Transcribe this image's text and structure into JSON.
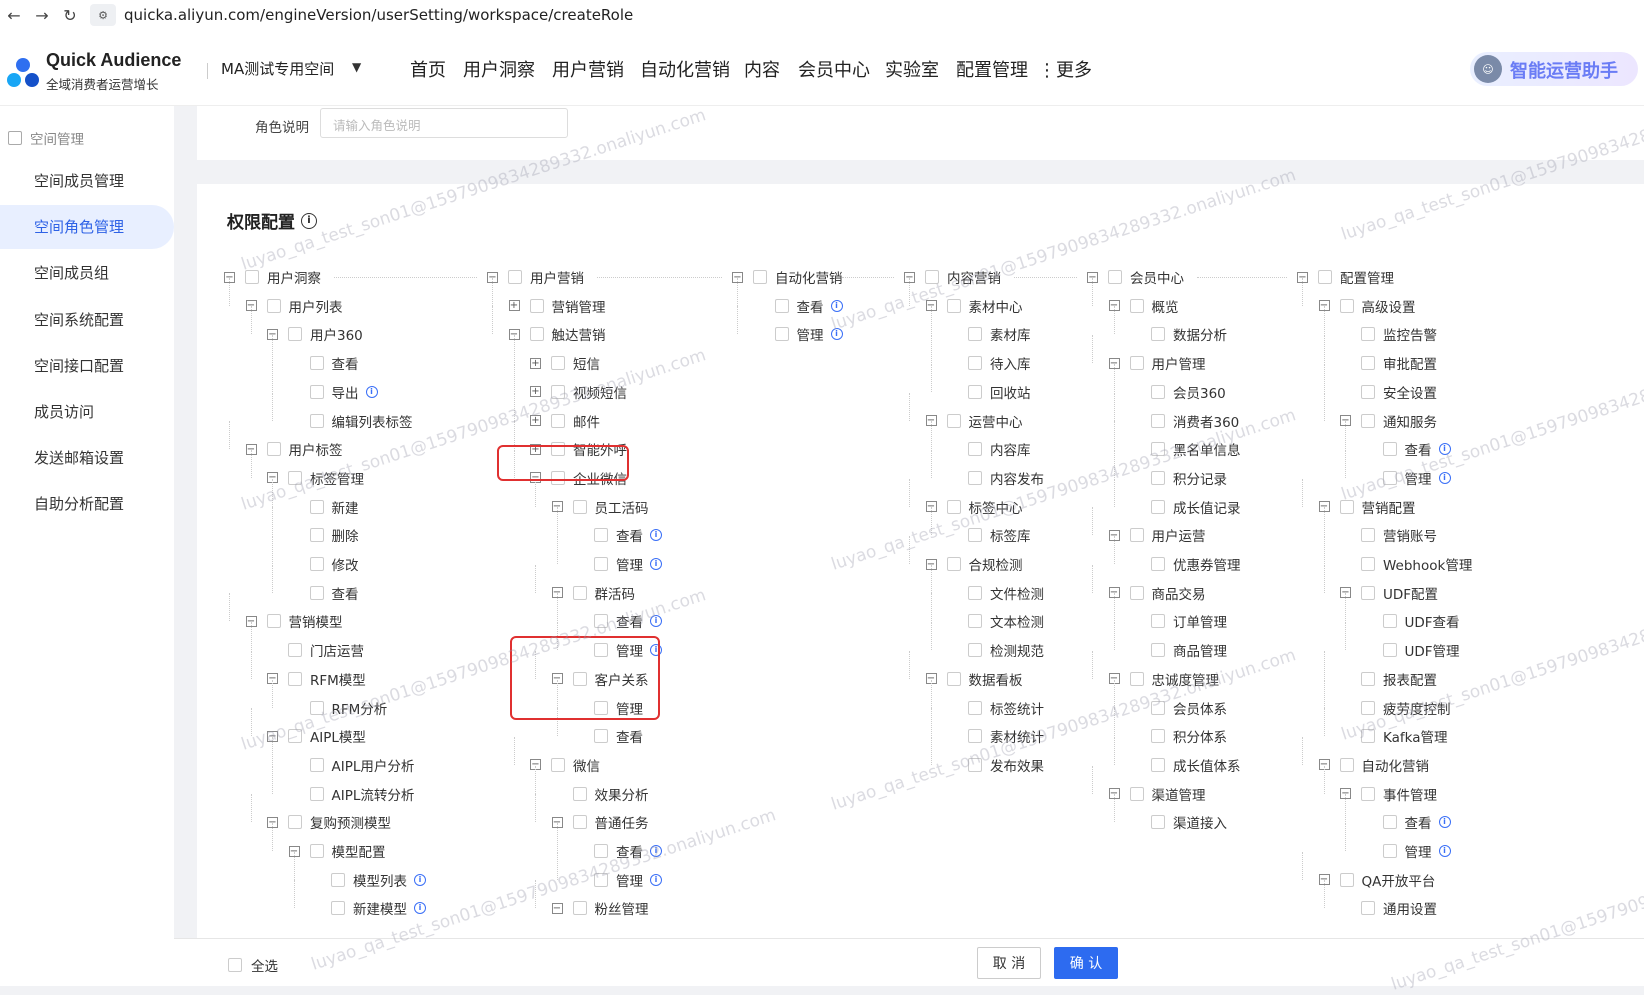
{
  "browser": {
    "url": "quicka.aliyun.com/engineVersion/userSetting/workspace/createRole"
  },
  "header": {
    "brand": "Quick Audience",
    "brand_sub": "全域消费者运营增长",
    "workspace": "MA测试专用空间",
    "menu": [
      "首页",
      "用户洞察",
      "用户营销",
      "自动化营销",
      "内容",
      "会员中心",
      "实验室",
      "配置管理",
      "更多"
    ],
    "ai_assistant": "智能运营助手"
  },
  "sidebar": {
    "group": "空间管理",
    "items": [
      "空间成员管理",
      "空间角色管理",
      "空间成员组",
      "空间系统配置",
      "空间接口配置",
      "成员访问",
      "发送邮箱设置",
      "自助分析配置"
    ],
    "active_index": 1
  },
  "role_desc": {
    "label": "角色说明",
    "placeholder": "请输入角色说明"
  },
  "perm": {
    "title": "权限配置",
    "columns": [
      [
        {
          "t": "用户洞察",
          "d": 0,
          "tog": "−"
        },
        {
          "t": "用户列表",
          "d": 1,
          "tog": "−"
        },
        {
          "t": "用户360",
          "d": 2,
          "tog": "−"
        },
        {
          "t": "查看",
          "d": 3
        },
        {
          "t": "导出",
          "d": 3,
          "info": true
        },
        {
          "t": "编辑列表标签",
          "d": 3
        },
        {
          "t": "用户标签",
          "d": 1,
          "tog": "−"
        },
        {
          "t": "标签管理",
          "d": 2,
          "tog": "−"
        },
        {
          "t": "新建",
          "d": 3
        },
        {
          "t": "删除",
          "d": 3
        },
        {
          "t": "修改",
          "d": 3
        },
        {
          "t": "查看",
          "d": 3
        },
        {
          "t": "营销模型",
          "d": 1,
          "tog": "−"
        },
        {
          "t": "门店运营",
          "d": 2
        },
        {
          "t": "RFM模型",
          "d": 2,
          "tog": "−"
        },
        {
          "t": "RFM分析",
          "d": 3
        },
        {
          "t": "AIPL模型",
          "d": 2,
          "tog": "−"
        },
        {
          "t": "AIPL用户分析",
          "d": 3
        },
        {
          "t": "AIPL流转分析",
          "d": 3
        },
        {
          "t": "复购预测模型",
          "d": 2,
          "tog": "−"
        },
        {
          "t": "模型配置",
          "d": 3,
          "tog": "−"
        },
        {
          "t": "模型列表",
          "d": 4,
          "info": true
        },
        {
          "t": "新建模型",
          "d": 4,
          "info": true
        }
      ],
      [
        {
          "t": "用户营销",
          "d": 0,
          "tog": "−"
        },
        {
          "t": "营销管理",
          "d": 1,
          "tog": "+"
        },
        {
          "t": "触达营销",
          "d": 1,
          "tog": "−"
        },
        {
          "t": "短信",
          "d": 2,
          "tog": "+"
        },
        {
          "t": "视频短信",
          "d": 2,
          "tog": "+"
        },
        {
          "t": "邮件",
          "d": 2,
          "tog": "+"
        },
        {
          "t": "智能外呼",
          "d": 2,
          "tog": "+"
        },
        {
          "t": "企业微信",
          "d": 2,
          "tog": "−"
        },
        {
          "t": "员工活码",
          "d": 3,
          "tog": "−"
        },
        {
          "t": "查看",
          "d": 4,
          "info": true
        },
        {
          "t": "管理",
          "d": 4,
          "info": true
        },
        {
          "t": "群活码",
          "d": 3,
          "tog": "−"
        },
        {
          "t": "查看",
          "d": 4,
          "info": true
        },
        {
          "t": "管理",
          "d": 4,
          "info": true
        },
        {
          "t": "客户关系",
          "d": 3,
          "tog": "−"
        },
        {
          "t": "管理",
          "d": 4
        },
        {
          "t": "查看",
          "d": 4
        },
        {
          "t": "微信",
          "d": 2,
          "tog": "−"
        },
        {
          "t": "效果分析",
          "d": 3
        },
        {
          "t": "普通任务",
          "d": 3,
          "tog": "−"
        },
        {
          "t": "查看",
          "d": 4,
          "info": true
        },
        {
          "t": "管理",
          "d": 4,
          "info": true
        },
        {
          "t": "粉丝管理",
          "d": 3,
          "tog": "−"
        }
      ],
      [
        {
          "t": "自动化营销",
          "d": 0,
          "tog": "−"
        },
        {
          "t": "查看",
          "d": 1,
          "info": true
        },
        {
          "t": "管理",
          "d": 1,
          "info": true
        }
      ],
      [
        {
          "t": "内容营销",
          "d": 0,
          "tog": "−"
        },
        {
          "t": "素材中心",
          "d": 1,
          "tog": "−"
        },
        {
          "t": "素材库",
          "d": 2
        },
        {
          "t": "待入库",
          "d": 2
        },
        {
          "t": "回收站",
          "d": 2
        },
        {
          "t": "运营中心",
          "d": 1,
          "tog": "−"
        },
        {
          "t": "内容库",
          "d": 2
        },
        {
          "t": "内容发布",
          "d": 2
        },
        {
          "t": "标签中心",
          "d": 1,
          "tog": "−"
        },
        {
          "t": "标签库",
          "d": 2
        },
        {
          "t": "合规检测",
          "d": 1,
          "tog": "−"
        },
        {
          "t": "文件检测",
          "d": 2
        },
        {
          "t": "文本检测",
          "d": 2
        },
        {
          "t": "检测规范",
          "d": 2
        },
        {
          "t": "数据看板",
          "d": 1,
          "tog": "−"
        },
        {
          "t": "标签统计",
          "d": 2
        },
        {
          "t": "素材统计",
          "d": 2
        },
        {
          "t": "发布效果",
          "d": 2
        }
      ],
      [
        {
          "t": "会员中心",
          "d": 0,
          "tog": "−"
        },
        {
          "t": "概览",
          "d": 1,
          "tog": "−"
        },
        {
          "t": "数据分析",
          "d": 2
        },
        {
          "t": "用户管理",
          "d": 1,
          "tog": "−"
        },
        {
          "t": "会员360",
          "d": 2
        },
        {
          "t": "消费者360",
          "d": 2
        },
        {
          "t": "黑名单信息",
          "d": 2
        },
        {
          "t": "积分记录",
          "d": 2
        },
        {
          "t": "成长值记录",
          "d": 2
        },
        {
          "t": "用户运营",
          "d": 1,
          "tog": "−"
        },
        {
          "t": "优惠券管理",
          "d": 2
        },
        {
          "t": "商品交易",
          "d": 1,
          "tog": "−"
        },
        {
          "t": "订单管理",
          "d": 2
        },
        {
          "t": "商品管理",
          "d": 2
        },
        {
          "t": "忠诚度管理",
          "d": 1,
          "tog": "−"
        },
        {
          "t": "会员体系",
          "d": 2
        },
        {
          "t": "积分体系",
          "d": 2
        },
        {
          "t": "成长值体系",
          "d": 2
        },
        {
          "t": "渠道管理",
          "d": 1,
          "tog": "−"
        },
        {
          "t": "渠道接入",
          "d": 2
        }
      ],
      [
        {
          "t": "配置管理",
          "d": 0,
          "tog": "−"
        },
        {
          "t": "高级设置",
          "d": 1,
          "tog": "−"
        },
        {
          "t": "监控告警",
          "d": 2
        },
        {
          "t": "审批配置",
          "d": 2
        },
        {
          "t": "安全设置",
          "d": 2
        },
        {
          "t": "通知服务",
          "d": 2,
          "tog": "−"
        },
        {
          "t": "查看",
          "d": 3,
          "info": true
        },
        {
          "t": "管理",
          "d": 3,
          "info": true
        },
        {
          "t": "营销配置",
          "d": 1,
          "tog": "−"
        },
        {
          "t": "营销账号",
          "d": 2
        },
        {
          "t": "Webhook管理",
          "d": 2
        },
        {
          "t": "UDF配置",
          "d": 2,
          "tog": "−"
        },
        {
          "t": "UDF查看",
          "d": 3
        },
        {
          "t": "UDF管理",
          "d": 3
        },
        {
          "t": "报表配置",
          "d": 2
        },
        {
          "t": "疲劳度控制",
          "d": 2
        },
        {
          "t": "Kafka管理",
          "d": 2
        },
        {
          "t": "自动化营销",
          "d": 1,
          "tog": "−"
        },
        {
          "t": "事件管理",
          "d": 2,
          "tog": "−"
        },
        {
          "t": "查看",
          "d": 3,
          "info": true
        },
        {
          "t": "管理",
          "d": 3,
          "info": true
        },
        {
          "t": "QA开放平台",
          "d": 1,
          "tog": "−"
        },
        {
          "t": "通用设置",
          "d": 2
        }
      ]
    ]
  },
  "footer": {
    "select_all": "全选",
    "cancel": "取 消",
    "confirm": "确 认"
  },
  "watermark": "luyao_qa_test_son01@1597909834289332.onaliyun.com"
}
